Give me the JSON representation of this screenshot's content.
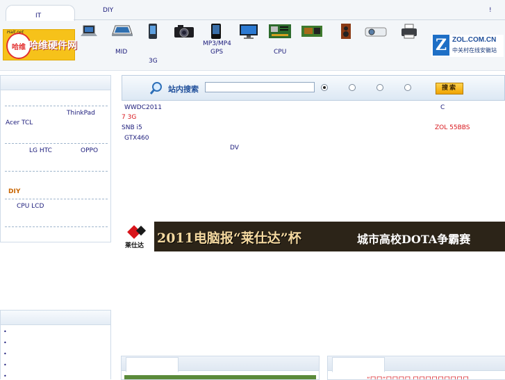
{
  "header": {
    "tab_it": "IT",
    "diy_link": "DIY",
    "excl": "!",
    "logo_small_text": "Hait.net",
    "logo_badge": "哈维",
    "logo_brand": "哈维硬件网",
    "products": [
      {
        "icon": "laptop-icon"
      },
      {
        "icon": "netbook-icon"
      },
      {
        "icon": "phone-icon"
      },
      {
        "icon": "camera-icon"
      },
      {
        "icon": "mp3-player-icon"
      },
      {
        "icon": "monitor-icon"
      },
      {
        "icon": "motherboard-icon"
      },
      {
        "icon": "graphics-card-icon"
      },
      {
        "icon": "speaker-icon"
      },
      {
        "icon": "projector-icon"
      },
      {
        "icon": "printer-icon"
      }
    ],
    "labels": {
      "mid": "MID",
      "mp3": "MP3/MP4",
      "gps": "GPS",
      "cpu": "CPU",
      "threeg": "3G"
    },
    "zol_logo": {
      "letter": "Z",
      "title": "ZOL.COM.CN",
      "subtitle": "中关村在线安徽站"
    }
  },
  "sidebar": {
    "links": {
      "thinkpad": "ThinkPad",
      "acer_tcl": "Acer TCL",
      "lg_htc": "LG HTC",
      "oppo": "OPPO",
      "diy": "DIY",
      "cpu_lcd": "CPU  LCD"
    },
    "bullets": [
      "•",
      "•",
      "•",
      "•",
      "•"
    ]
  },
  "search": {
    "label": "站内搜索",
    "input_value": "",
    "button": "搜索"
  },
  "news": {
    "wwdc": "WWDC2011",
    "c": "C",
    "seven_3g": "7  3G",
    "snb_i5": "SNB   i5",
    "zol_55bbs": "ZOL  55BBS",
    "gtx460": "GTX460",
    "dv": "DV"
  },
  "banner": {
    "logo_name": "莱仕达",
    "title": "2011电脑报“莱仕达”杯",
    "subtitle": "城市高校DOTA争霸赛"
  },
  "bottom": {
    "right_fragment": "“口口”口口口口  口口口口口口口口口"
  }
}
